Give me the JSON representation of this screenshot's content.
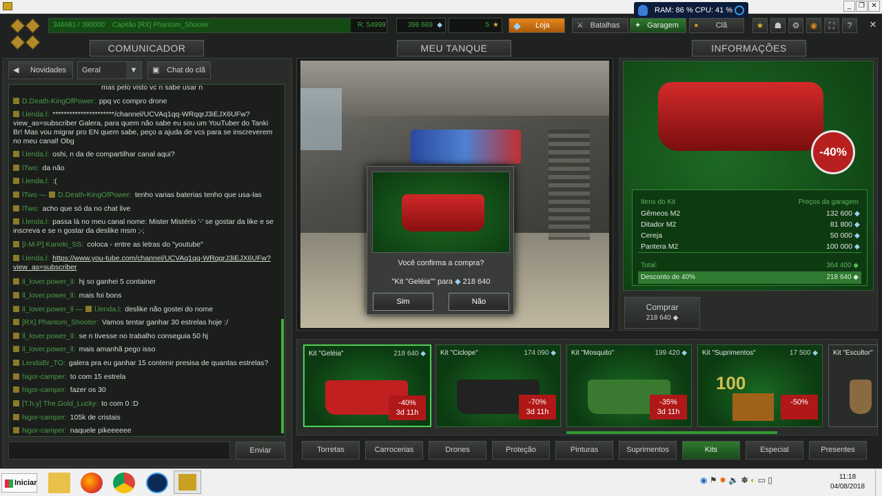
{
  "window": {
    "minimize": "_",
    "restore": "❐",
    "close": "✕"
  },
  "sysmon": {
    "text": "RAM: 86 %  CPU: 41 %"
  },
  "topbar": {
    "rank_progress": "346681 / 390000",
    "player": "Capitão [RX] Phantom_Shooter",
    "rating": "R: 54999",
    "crystals": "396 669",
    "stars": "5",
    "shop": "Loja",
    "battles": "Batalhas",
    "garage": "Garagem",
    "clan": "Clã"
  },
  "panels": {
    "left": "COMUNICADOR",
    "center": "MEU TANQUE",
    "right": "INFORMAÇÕES"
  },
  "chat": {
    "news_btn": "Novidades",
    "channel": "Geral",
    "clan_btn": "Chat do clã",
    "send_btn": "Enviar",
    "cut_line": "mas pelo visto vc n sabe usar n",
    "lines": [
      {
        "nick": "D.Death-KingOfPower:",
        "msg": "ppq vc compro drone"
      },
      {
        "nick": "l.lenda.l:",
        "msg": "**********************/channel/UCVAq1qq-WRqqrJ3iEJX6UFw?view_as=subscriber Galera, para quem não sabe eu sou um YouTuber do Tanki Br! Mas vou migrar pro EN quem sabe, peço a ajuda de vcs para se inscreverem no meu canal! Obg"
      },
      {
        "nick": "l.lenda.l:",
        "msg": "oshi, n da de compartilhar canal aqui?"
      },
      {
        "nick": "lTwo:",
        "msg": "da não"
      },
      {
        "nick": "l.lenda.l:",
        "msg": ":("
      },
      {
        "nick": "lTwo —",
        "msg": "tenho varias baterias tenho que usa-las",
        "nick2": "D.Death-KingOfPower:"
      },
      {
        "nick": "lTwo:",
        "msg": "acho que só da no chat live"
      },
      {
        "nick": "l.lenda.l:",
        "msg": "passa lá no meu canal nome: Mister Mistério '-' se gostar da like e se inscreva e se n gostar da deslike msm ;-;"
      },
      {
        "nick": "[I-M-P] Kaneki_SS:",
        "msg": "coloca - entre as letras do \"youtube\""
      },
      {
        "nick": "l.lenda.l:",
        "msg": "https://www.you-tube.com/channel/UCVAq1qq-WRqqrJ3iEJX6UFw?view_as=subscriber"
      },
      {
        "nick": "ll_lover.power_ll:",
        "msg": "hj so ganhei 5 container"
      },
      {
        "nick": "ll_lover.power_ll:",
        "msg": "mais foi bons"
      },
      {
        "nick": "ll_lover.power_ll —",
        "msg": "deslike não gostei do nome",
        "nick2": "l.lenda.l:"
      },
      {
        "nick": "[RX] Phantom_Shooter:",
        "msg": "Vamos tentar ganhar 30 estrelas hoje :/"
      },
      {
        "nick": "ll_lover.power_ll:",
        "msg": "se n tivesse no trabalho conseguia 50 hj"
      },
      {
        "nick": "ll_lover.power_ll:",
        "msg": "mais amanhã pego isso"
      },
      {
        "nick": "LendaBr_TO:",
        "msg": "galera pra eu ganhar 15 contenir presisa de quantas estrelas?"
      },
      {
        "nick": "higor-camper:",
        "msg": "to com 15 estrela"
      },
      {
        "nick": "higor-camper:",
        "msg": "fazer os 30"
      },
      {
        "nick": "[T.h.y] The.Gold_Lucky:",
        "msg": "to com 0 :D"
      },
      {
        "nick": "higor-camper:",
        "msg": "105k de cristais"
      },
      {
        "nick": "higor-camper:",
        "msg": "naquele pikeeeeee"
      }
    ]
  },
  "dialog": {
    "question": "Você confirma a compra?",
    "item": "\"Kit \"Geléia\"\" para",
    "price": "218 640",
    "yes": "Sim",
    "no": "Não"
  },
  "info": {
    "discount_badge": "-40%",
    "col_items": "Itens do Kit",
    "col_prices": "Preços da garagem",
    "items": [
      {
        "name": "Gêmeos M2",
        "price": "132 600"
      },
      {
        "name": "Ditador M2",
        "price": "81 800"
      },
      {
        "name": "Cereja",
        "price": "50 000"
      },
      {
        "name": "Pantera  M2",
        "price": "100 000"
      }
    ],
    "total_label": "Total:",
    "total": "364 400",
    "discount_label": "Desconto de 40%",
    "discount_price": "218 640",
    "buy_label": "Comprar",
    "buy_price": "218 640"
  },
  "kits": [
    {
      "name": "Kit \"Geléia\"",
      "price": "218 640",
      "disc": "-40%",
      "time": "3d 11h"
    },
    {
      "name": "Kit \"Ciclope\"",
      "price": "174 090",
      "disc": "-70%",
      "time": "3d 11h"
    },
    {
      "name": "Kit \"Mosquito\"",
      "price": "199 420",
      "disc": "-35%",
      "time": "3d 11h"
    },
    {
      "name": "Kit \"Suprimentos\"",
      "price": "17 500",
      "disc": "-50%",
      "time": ""
    },
    {
      "name": "Kit \"Escultor\"",
      "price": "",
      "disc": "",
      "time": ""
    }
  ],
  "kit_supplies_number": "100",
  "tabs": [
    "Torretas",
    "Carrocerias",
    "Drones",
    "Proteção",
    "Pinturas",
    "Suprimentos",
    "Kits",
    "Especial",
    "Presentes"
  ],
  "taskbar": {
    "start": "Iniciar",
    "time": "11:18",
    "date": "04/08/2018"
  }
}
